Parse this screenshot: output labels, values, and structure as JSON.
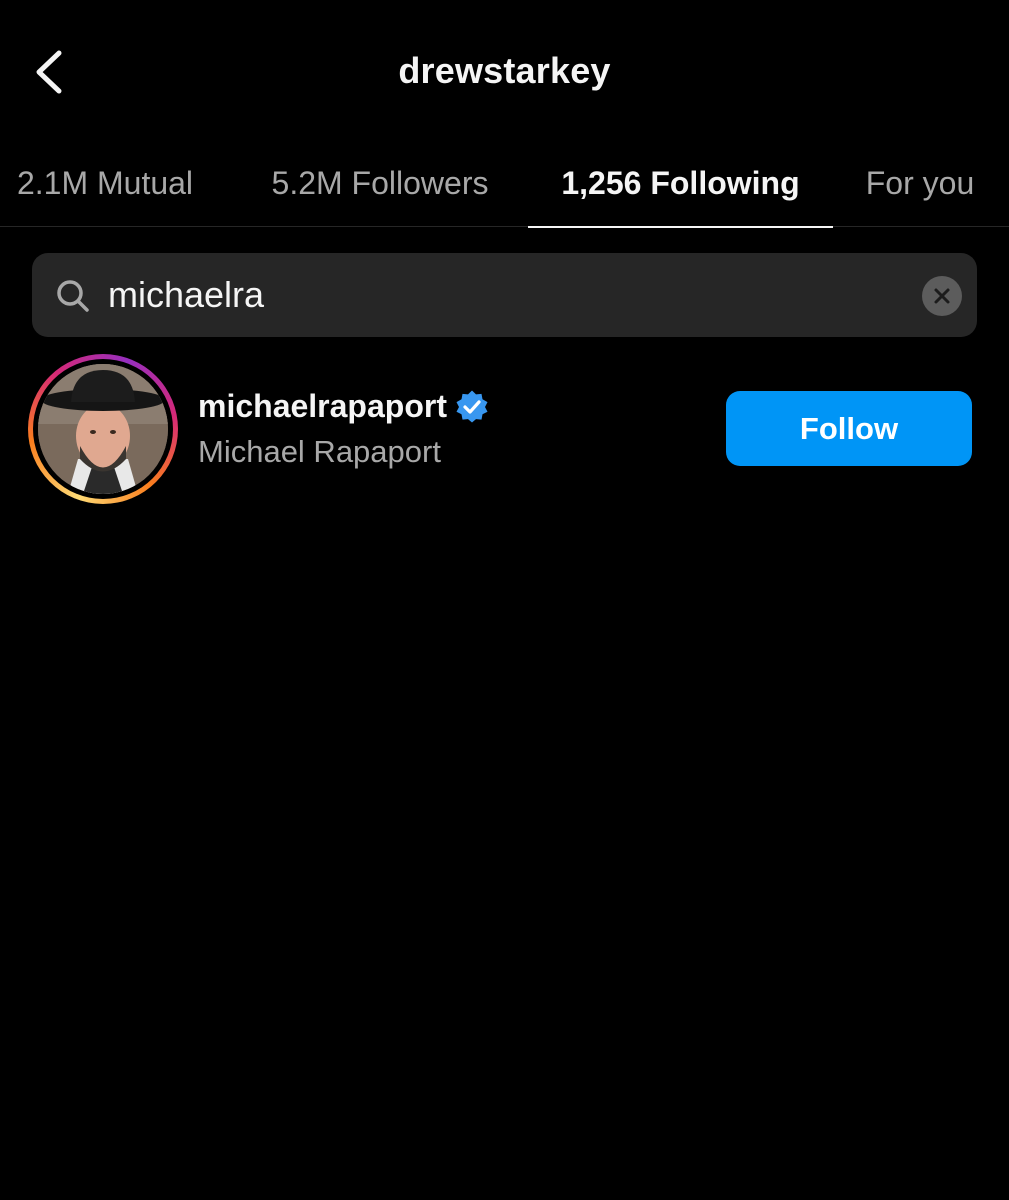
{
  "header": {
    "title": "drewstarkey",
    "back_icon": "chevron-left-icon"
  },
  "tabs": [
    {
      "label": "2.1M Mutual",
      "active": false
    },
    {
      "label": "5.2M Followers",
      "active": false
    },
    {
      "label": "1,256 Following",
      "active": true
    },
    {
      "label": "For you",
      "active": false
    }
  ],
  "search": {
    "value": "michaelra",
    "icon": "search-icon",
    "clear_icon": "close-icon"
  },
  "results": [
    {
      "username": "michaelrapaport",
      "full_name": "Michael Rapaport",
      "verified": true,
      "has_story_ring": true,
      "button_label": "Follow"
    }
  ],
  "colors": {
    "background": "#000000",
    "primary_text": "#f5f5f5",
    "secondary_text": "#a8a8a8",
    "search_bg": "#262626",
    "follow_button": "#0095f6",
    "verified_badge": "#3897f0"
  }
}
